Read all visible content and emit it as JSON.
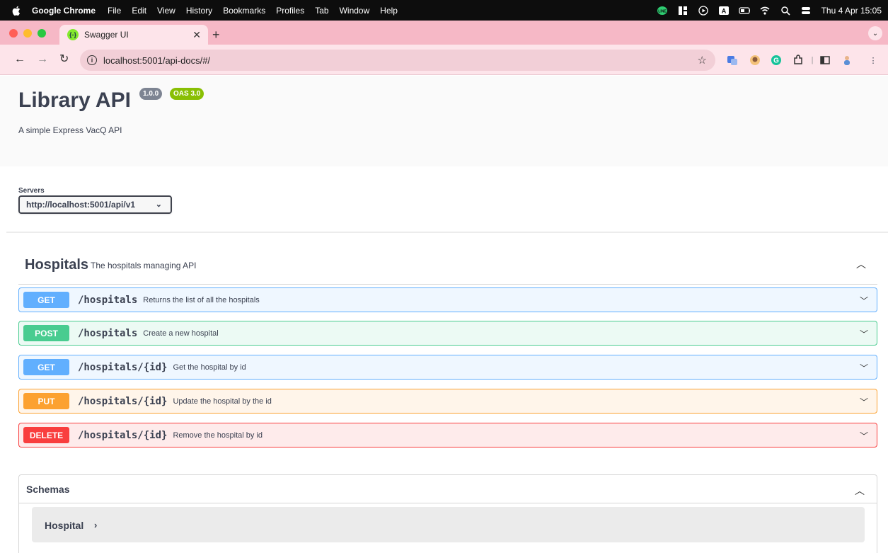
{
  "menubar": {
    "app_name": "Google Chrome",
    "items": [
      "File",
      "Edit",
      "View",
      "History",
      "Bookmarks",
      "Profiles",
      "Tab",
      "Window",
      "Help"
    ],
    "status_a": "A",
    "clock": "Thu 4 Apr  15:05"
  },
  "browser": {
    "tab_title": "Swagger UI",
    "tab_favicon": "{-}",
    "url": "localhost:5001/api-docs/#/",
    "colors": {
      "tab_strip": "#f6b8c6",
      "toolbar": "#fde4ea"
    }
  },
  "swagger": {
    "title": "Library API",
    "version_badge": "1.0.0",
    "oas_badge": "OAS 3.0",
    "description": "A simple Express VacQ API",
    "servers_label": "Servers",
    "servers_selected": "http://localhost:5001/api/v1",
    "tag": {
      "name": "Hospitals",
      "description": "The hospitals managing API"
    },
    "operations": [
      {
        "method": "GET",
        "path": "/hospitals",
        "summary": "Returns the list of all the hospitals"
      },
      {
        "method": "POST",
        "path": "/hospitals",
        "summary": "Create a new hospital"
      },
      {
        "method": "GET",
        "path": "/hospitals/{id}",
        "summary": "Get the hospital by id"
      },
      {
        "method": "PUT",
        "path": "/hospitals/{id}",
        "summary": "Update the hospital by the id"
      },
      {
        "method": "DELETE",
        "path": "/hospitals/{id}",
        "summary": "Remove the hospital by id"
      }
    ],
    "schemas_title": "Schemas",
    "schema_models": [
      "Hospital"
    ],
    "colors": {
      "get": "#61affe",
      "post": "#49cc90",
      "put": "#fca130",
      "delete": "#f93e3e",
      "version_badge": "#89bf04",
      "oas_badge": "#7d8492"
    }
  }
}
